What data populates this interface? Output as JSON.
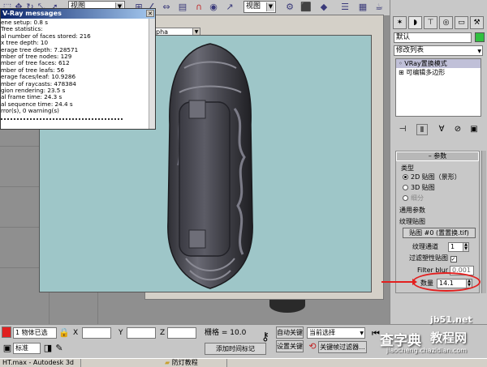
{
  "toolbar": {
    "view_dropdown": "视图",
    "view_dropdown_2": "视图"
  },
  "render_frame": {
    "channel_dropdown": "pha"
  },
  "vray_messages": {
    "title": "V-Ray messages",
    "lines": [
      "ene setup: 0.8 s",
      "Tree statistics:",
      "al number of faces stored: 216",
      "x tree depth: 10",
      "erage tree depth: 7.28571",
      "mber of tree nodes: 129",
      "mber of tree faces: 612",
      "mber of tree leafs: 56",
      "erage faces/leaf: 10.9286",
      "mber of raycasts: 478384",
      "gion rendering: 23.5 s",
      "al frame time: 24.3 s",
      "al sequence time: 24.4 s",
      "rror(s), 0 warning(s)"
    ]
  },
  "command_panel": {
    "object_name": "默认",
    "modifier_list": "修改列表",
    "stack_items": [
      "VRay置换模式",
      "可编辑多边形"
    ],
    "params_title": "参数",
    "type_label": "类型",
    "type_options": [
      "2D 贴图（景形）",
      "3D 贴图",
      "细分"
    ],
    "common_params_label": "通用参数",
    "texmap_label": "纹理贴图",
    "texmap_button": "贴图 #0 (置置换.tif)",
    "texmap_channel_label": "纹理通道",
    "texmap_channel_value": "1",
    "filter_map_label": "过滤塑性贴图",
    "filter_blur_label": "Filter blur",
    "filter_blur_value": "0.001",
    "amount_label": "数量",
    "amount_value": "14.1"
  },
  "statusbar": {
    "selected_count": "1 物体已选",
    "x_label": "X",
    "y_label": "Y",
    "z_label": "Z",
    "x_value": "",
    "y_value": "",
    "z_value": "",
    "grid_label": "栅格 = 10.0",
    "add_time_tag": "添加时间标记",
    "auto_key": "自动关键帧",
    "set_key": "设置关键帧",
    "current_selection": "当前选择",
    "key_filters": "关键帧过滤器...",
    "standard_label": "标准"
  },
  "taskbar": {
    "items": [
      "HT.max - Autodesk 3d",
      "防灯教程"
    ]
  },
  "watermark": {
    "site": "jb51.net",
    "brand": "查字典",
    "brand2": "教程网",
    "url": "jiaocheng.chazidian.com"
  },
  "colors": {
    "render_background": "#9ec6c8",
    "annotation_red": "#e3201f",
    "vray_title": "#0a246a"
  }
}
